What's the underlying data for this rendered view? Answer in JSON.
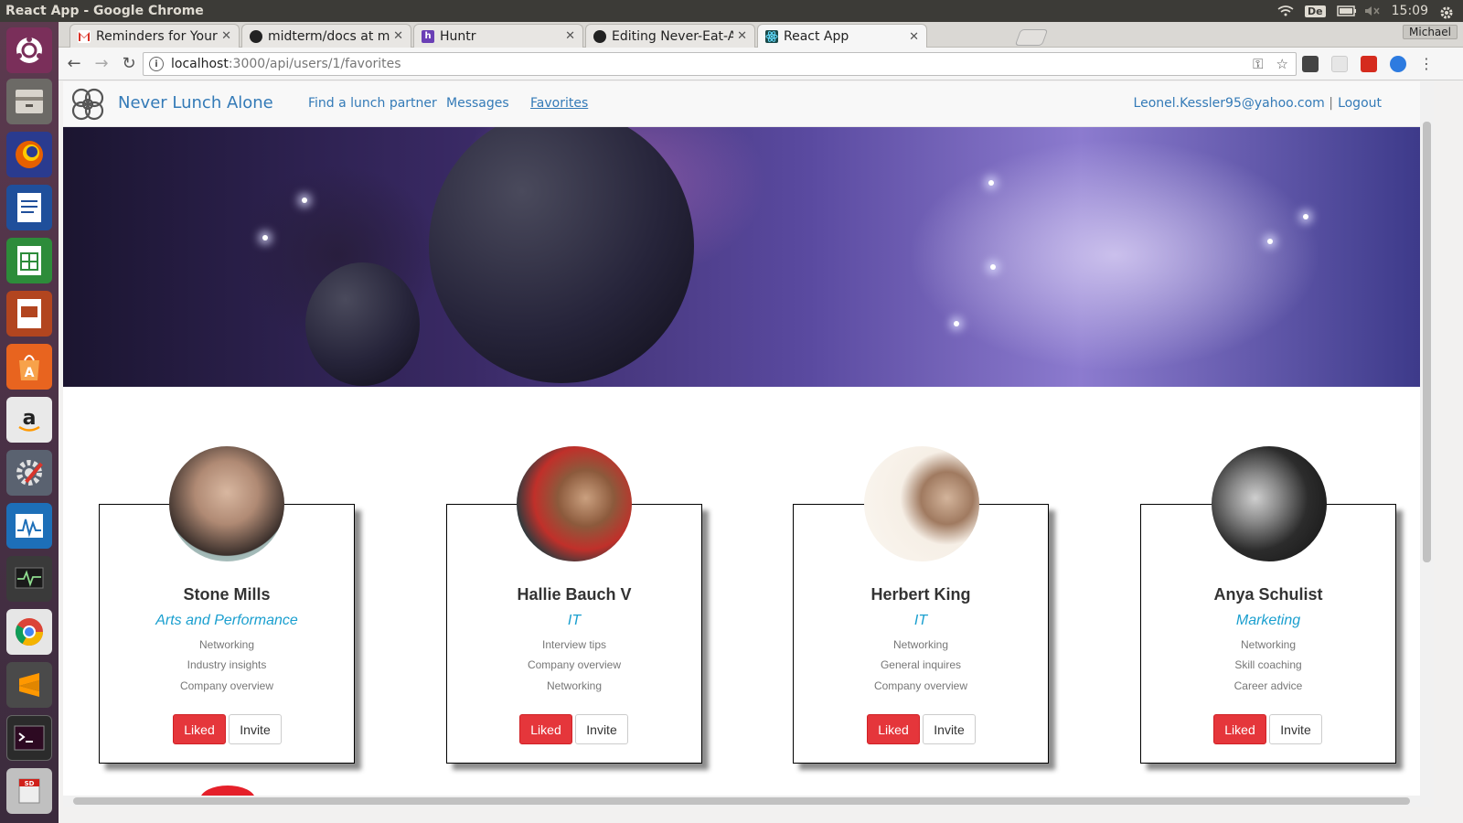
{
  "os": {
    "window_title": "React App - Google Chrome",
    "keyboard": "De",
    "time": "15:09"
  },
  "browser": {
    "tabs": [
      {
        "label": "Reminders for Your",
        "icon": "gmail-icon",
        "color": "#d93025"
      },
      {
        "label": "midterm/docs at m",
        "icon": "github-icon",
        "color": "#222222"
      },
      {
        "label": "Huntr",
        "icon": "huntr-icon",
        "color": "#6a3fb5"
      },
      {
        "label": "Editing Never-Eat-A",
        "icon": "github-icon",
        "color": "#222222"
      },
      {
        "label": "React App",
        "icon": "react-icon",
        "color": "#1b8a8a"
      }
    ],
    "profile": "Michael",
    "url_host": "localhost",
    "url_path": ":3000/api/users/1/favorites"
  },
  "app": {
    "brand": "Never Lunch Alone",
    "nav": {
      "find": "Find a lunch partner",
      "messages": "Messages",
      "favorites": "Favorites"
    },
    "user_email": "Leonel.Kessler95@yahoo.com",
    "separator": "|",
    "logout": "Logout"
  },
  "cards": [
    {
      "name": "Stone Mills",
      "dept": "Arts and Performance",
      "topics": [
        "Networking",
        "Industry insights",
        "Company overview"
      ],
      "liked": "Liked",
      "invite": "Invite"
    },
    {
      "name": "Hallie Bauch V",
      "dept": "IT",
      "topics": [
        "Interview tips",
        "Company overview",
        "Networking"
      ],
      "liked": "Liked",
      "invite": "Invite"
    },
    {
      "name": "Herbert King",
      "dept": "IT",
      "topics": [
        "Networking",
        "General inquires",
        "Company overview"
      ],
      "liked": "Liked",
      "invite": "Invite"
    },
    {
      "name": "Anya Schulist",
      "dept": "Marketing",
      "topics": [
        "Networking",
        "Skill coaching",
        "Career advice"
      ],
      "liked": "Liked",
      "invite": "Invite"
    }
  ],
  "colors": {
    "accent": "#337ab7",
    "liked": "#e5363b",
    "dept": "#1a9fcf"
  }
}
